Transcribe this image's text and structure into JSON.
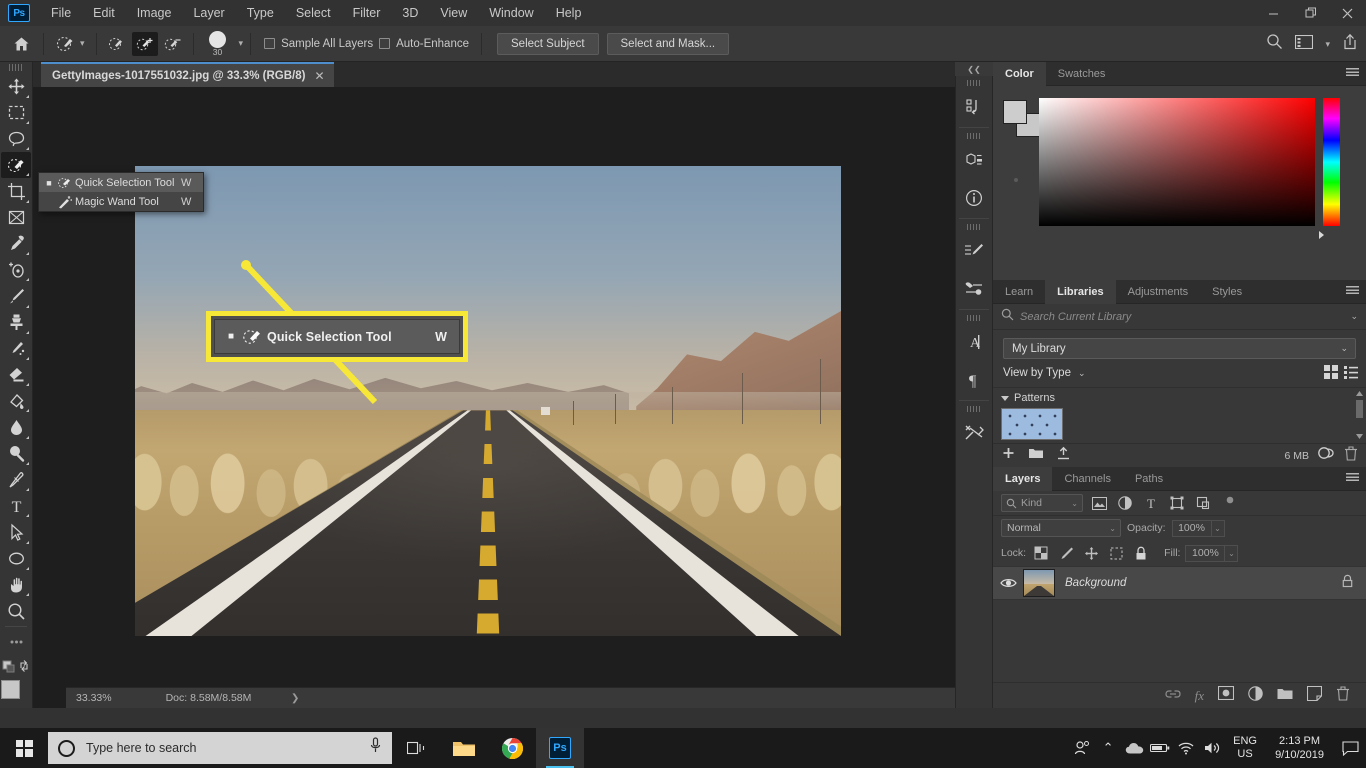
{
  "window": {
    "minimize_label": "–",
    "restore_label": "❐",
    "close_label": "✕"
  },
  "menubar": {
    "logo": "Ps",
    "items": [
      {
        "label": "File"
      },
      {
        "label": "Edit"
      },
      {
        "label": "Image"
      },
      {
        "label": "Layer"
      },
      {
        "label": "Type"
      },
      {
        "label": "Select"
      },
      {
        "label": "Filter"
      },
      {
        "label": "3D"
      },
      {
        "label": "View"
      },
      {
        "label": "Window"
      },
      {
        "label": "Help"
      }
    ]
  },
  "options_bar": {
    "brush_size": "30",
    "sample_all_layers": "Sample All Layers",
    "auto_enhance": "Auto-Enhance",
    "select_subject": "Select Subject",
    "select_and_mask": "Select and Mask...",
    "icons": [
      "home-icon",
      "tool-preset-icon",
      "new-selection-icon",
      "add-to-selection-icon",
      "subtract-from-selection-icon",
      "brush-size-icon",
      "search-icon",
      "workspace-icon",
      "share-icon"
    ]
  },
  "toolbar": {
    "tools": [
      {
        "name": "move-tool"
      },
      {
        "name": "rectangular-marquee-tool"
      },
      {
        "name": "lasso-tool"
      },
      {
        "name": "quick-selection-tool"
      },
      {
        "name": "crop-tool"
      },
      {
        "name": "frame-tool"
      },
      {
        "name": "eyedropper-tool"
      },
      {
        "name": "spot-healing-brush-tool"
      },
      {
        "name": "brush-tool"
      },
      {
        "name": "clone-stamp-tool"
      },
      {
        "name": "history-brush-tool"
      },
      {
        "name": "eraser-tool"
      },
      {
        "name": "gradient-tool"
      },
      {
        "name": "blur-tool"
      },
      {
        "name": "dodge-tool"
      },
      {
        "name": "pen-tool"
      },
      {
        "name": "type-tool"
      },
      {
        "name": "path-selection-tool"
      },
      {
        "name": "ellipse-tool"
      },
      {
        "name": "hand-tool"
      },
      {
        "name": "zoom-tool"
      },
      {
        "name": "edit-toolbar-tool"
      }
    ],
    "type_tool_label": "T"
  },
  "flyout": {
    "items": [
      {
        "label": "Quick Selection Tool",
        "shortcut": "W",
        "selected": true
      },
      {
        "label": "Magic Wand Tool",
        "shortcut": "W",
        "selected": false
      }
    ]
  },
  "callout": {
    "label": "Quick Selection Tool",
    "shortcut": "W",
    "highlight_color": "#f7e736"
  },
  "document": {
    "tab_title": "GettyImages-1017551032.jpg @ 33.3% (RGB/8)",
    "close_label": "✕"
  },
  "status_bar": {
    "zoom": "33.33%",
    "doc_size": "Doc: 8.58M/8.58M",
    "arrow": "❯"
  },
  "icon_dock": {
    "collapse": "❮❮",
    "items": [
      {
        "name": "history-icon"
      },
      {
        "name": "properties-icon"
      },
      {
        "name": "info-icon"
      },
      {
        "name": "brushes-icon"
      },
      {
        "name": "brush-settings-icon"
      },
      {
        "name": "character-icon"
      },
      {
        "name": "paragraph-icon"
      },
      {
        "name": "tool-presets-icon"
      }
    ]
  },
  "color_panel": {
    "tabs": [
      {
        "label": "Color",
        "active": true
      },
      {
        "label": "Swatches",
        "active": false
      }
    ]
  },
  "libraries_panel": {
    "tabs": [
      {
        "label": "Learn",
        "active": false
      },
      {
        "label": "Libraries",
        "active": true
      },
      {
        "label": "Adjustments",
        "active": false
      },
      {
        "label": "Styles",
        "active": false
      }
    ],
    "search_placeholder": "Search Current Library",
    "library_select": "My Library",
    "view_by": "View by Type",
    "group_title": "Patterns",
    "size_label": "6 MB",
    "footer_icons": [
      "add-item-icon",
      "new-group-icon",
      "upload-icon",
      "creative-cloud-icon",
      "delete-icon"
    ]
  },
  "layers_panel": {
    "tabs": [
      {
        "label": "Layers",
        "active": true
      },
      {
        "label": "Channels",
        "active": false
      },
      {
        "label": "Paths",
        "active": false
      }
    ],
    "filter_kind": "Kind",
    "blend_mode": "Normal",
    "opacity_label": "Opacity:",
    "opacity_value": "100%",
    "lock_label": "Lock:",
    "fill_label": "Fill:",
    "fill_value": "100%",
    "layers": [
      {
        "name": "Background",
        "visible": true,
        "locked": true
      }
    ],
    "footer_icons": [
      "link-layers-icon",
      "layer-style-icon",
      "layer-mask-icon",
      "adjustment-layer-icon",
      "new-group-icon",
      "new-layer-icon",
      "delete-layer-icon"
    ],
    "fx_label": "fx"
  },
  "taskbar": {
    "search_placeholder": "Type here to search",
    "icons": [
      "start-icon",
      "cortana-circle-icon",
      "microphone-icon",
      "task-view-icon",
      "file-explorer-icon",
      "chrome-icon",
      "photoshop-icon"
    ],
    "photoshop_label": "Ps",
    "tray": {
      "people_icon": "people-icon",
      "chevron_up": "⌃",
      "onedrive_icon": "onedrive-icon",
      "battery_icon": "battery-icon",
      "wifi_icon": "wifi-icon",
      "volume_icon": "volume-icon",
      "language_line1": "ENG",
      "language_line2": "US",
      "time": "2:13 PM",
      "date": "9/10/2019",
      "notification_icon": "notification-icon"
    }
  }
}
